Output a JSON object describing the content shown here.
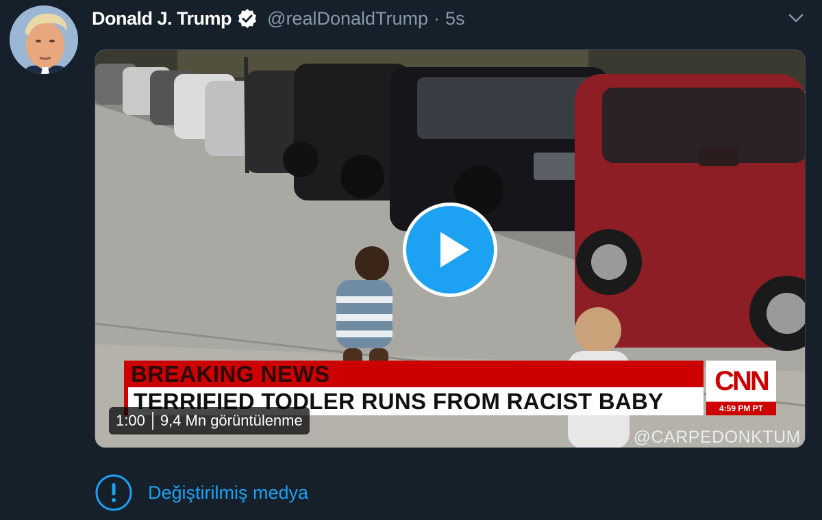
{
  "tweet": {
    "author_name": "Donald J. Trump",
    "handle": "@realDonaldTrump",
    "separator": "·",
    "timestamp": "5s"
  },
  "media": {
    "chyron_top": "BREAKING NEWS",
    "chyron_headline": "TERRIFIED TODLER RUNS FROM RACIST BABY",
    "network_logo": "CNN",
    "network_time": "4:59 PM PT",
    "watermark": "@CARPEDONKTUM",
    "duration": "1:00",
    "views": "9,4 Mn görüntülenme"
  },
  "notice": {
    "text": "Değiştirilmiş medya",
    "icon": "exclamation-circle-icon"
  },
  "colors": {
    "background": "#15202b",
    "accent": "#1da1f2",
    "secondary_text": "#8899a6",
    "news_red": "#cc0000"
  }
}
